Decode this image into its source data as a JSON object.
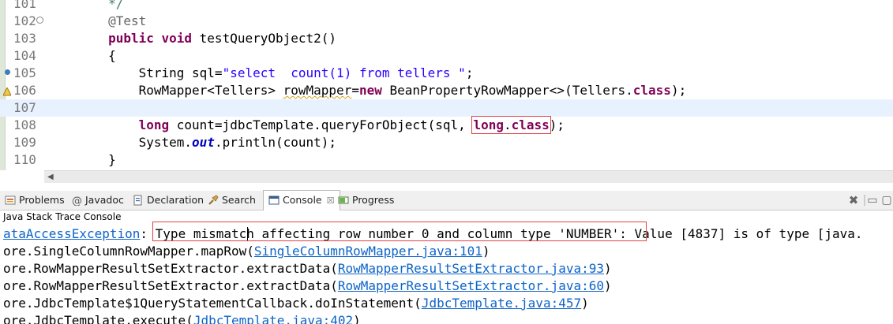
{
  "editor": {
    "lines": [
      {
        "num": "101",
        "code": [
          {
            "t": "        */",
            "c": "cmt"
          }
        ]
      },
      {
        "num": "102",
        "fold": "⊖",
        "code": [
          {
            "t": "        ",
            "c": ""
          },
          {
            "t": "@Test",
            "c": "ann"
          }
        ]
      },
      {
        "num": "103",
        "code": [
          {
            "t": "        ",
            "c": ""
          },
          {
            "t": "public",
            "c": "kw"
          },
          {
            "t": " ",
            "c": ""
          },
          {
            "t": "void",
            "c": "kw"
          },
          {
            "t": " testQueryObject2()",
            "c": ""
          }
        ]
      },
      {
        "num": "104",
        "code": [
          {
            "t": "        {",
            "c": ""
          }
        ]
      },
      {
        "num": "105",
        "marker": "dot",
        "code": [
          {
            "t": "            String sql=",
            "c": ""
          },
          {
            "t": "\"select  count(1) from tellers \"",
            "c": "str"
          },
          {
            "t": ";",
            "c": ""
          }
        ]
      },
      {
        "num": "106",
        "marker": "warn",
        "code": [
          {
            "t": "            RowMapper<Tellers> ",
            "c": ""
          },
          {
            "t": "rowMapper",
            "c": "squig"
          },
          {
            "t": "=",
            "c": ""
          },
          {
            "t": "new",
            "c": "kw"
          },
          {
            "t": " BeanPropertyRowMapper<>(Tellers.",
            "c": ""
          },
          {
            "t": "class",
            "c": "kw"
          },
          {
            "t": ");",
            "c": ""
          }
        ]
      },
      {
        "num": "107",
        "current": true,
        "code": [
          {
            "t": "",
            "c": ""
          }
        ]
      },
      {
        "num": "108",
        "code": [
          {
            "t": "            ",
            "c": ""
          },
          {
            "t": "long",
            "c": "kw"
          },
          {
            "t": " count=jdbcTemplate.queryForObject(sql, ",
            "c": ""
          },
          {
            "t": "long",
            "c": "kw box"
          },
          {
            "t": ".",
            "c": "box"
          },
          {
            "t": "class",
            "c": "kw box"
          },
          {
            "t": ");",
            "c": ""
          }
        ]
      },
      {
        "num": "109",
        "code": [
          {
            "t": "            System.",
            "c": ""
          },
          {
            "t": "out",
            "c": "fld"
          },
          {
            "t": ".println(count);",
            "c": ""
          }
        ]
      },
      {
        "num": "110",
        "code": [
          {
            "t": "        }",
            "c": ""
          }
        ]
      }
    ]
  },
  "tabs": [
    {
      "label": "Problems",
      "icon": "problems-icon",
      "active": false
    },
    {
      "label": "Javadoc",
      "icon": "at-icon",
      "active": false
    },
    {
      "label": "Declaration",
      "icon": "declaration-icon",
      "active": false
    },
    {
      "label": "Search",
      "icon": "search-icon",
      "active": false
    },
    {
      "label": "Console",
      "icon": "console-icon",
      "active": true,
      "close": "☒"
    },
    {
      "label": "Progress",
      "icon": "progress-icon",
      "active": false
    }
  ],
  "console": {
    "title": "Java Stack Trace Console",
    "line1": {
      "exception": "ataAccessException",
      "colon": ":",
      "message": " Type mismatch affecting row number 0 and column type 'NUMBER'",
      "rest": ": Value [4837] is of type [java."
    },
    "frames": [
      {
        "prefix": "ore.SingleColumnRowMapper.mapRow(",
        "link": "SingleColumnRowMapper.java:101",
        "suffix": ")"
      },
      {
        "prefix": "ore.RowMapperResultSetExtractor.extractData(",
        "link": "RowMapperResultSetExtractor.java:93",
        "suffix": ")"
      },
      {
        "prefix": "ore.RowMapperResultSetExtractor.extractData(",
        "link": "RowMapperResultSetExtractor.java:60",
        "suffix": ")"
      },
      {
        "prefix": "ore.JdbcTemplate$1QueryStatementCallback.doInStatement(",
        "link": "JdbcTemplate.java:457",
        "suffix": ")"
      },
      {
        "prefix": "ore.JdbcTemplate.execute(",
        "link": "JdbcTemplate.java:402",
        "suffix": ")"
      }
    ]
  },
  "colors": {
    "keyword": "#7f0055",
    "string": "#2a00ff",
    "link": "#0d64c8",
    "highlight": "#e0424a"
  }
}
